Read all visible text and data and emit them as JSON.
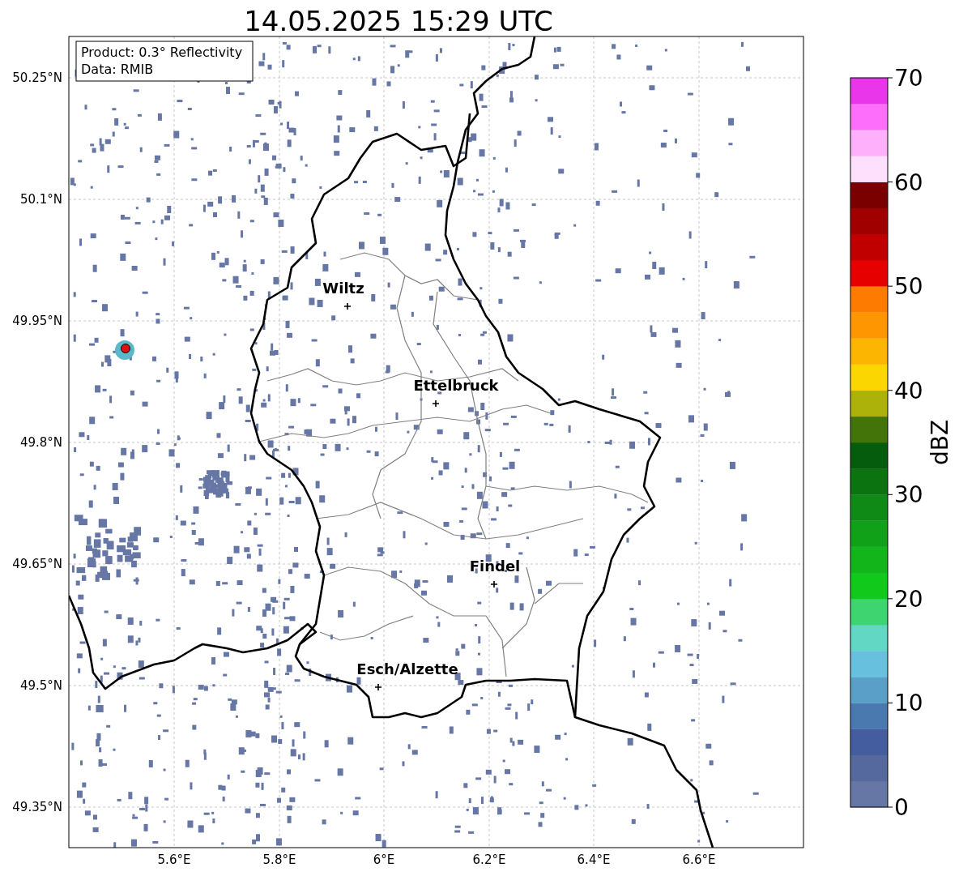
{
  "title": "14.05.2025 15:29 UTC",
  "info_box": [
    "Product: 0.3° Reflectivity",
    "Data: RMIB"
  ],
  "lat_labels": [
    "50.25°N",
    "50.1°N",
    "49.95°N",
    "49.8°N",
    "49.65°N",
    "49.5°N",
    "49.35°N"
  ],
  "lon_labels": [
    "5.6°E",
    "5.8°E",
    "6°E",
    "6.2°E",
    "6.4°E",
    "6.6°E"
  ],
  "places": [
    {
      "name": "Wiltz"
    },
    {
      "name": "Ettelbruck"
    },
    {
      "name": "Findel"
    },
    {
      "name": "Esch/Alzette"
    }
  ],
  "colorbar": {
    "label": "dBZ",
    "ticks": [
      "70",
      "60",
      "50",
      "40",
      "30",
      "20",
      "10",
      "0"
    ],
    "bins": [
      {
        "color": "#6677a5"
      },
      {
        "color": "#55699f"
      },
      {
        "color": "#435d9f"
      },
      {
        "color": "#4a79b0"
      },
      {
        "color": "#5a9fc8"
      },
      {
        "color": "#67c1de"
      },
      {
        "color": "#62d7c4"
      },
      {
        "color": "#3ed571"
      },
      {
        "color": "#11c91b"
      },
      {
        "color": "#12b51a"
      },
      {
        "color": "#10a118"
      },
      {
        "color": "#0f8a17"
      },
      {
        "color": "#0b7411"
      },
      {
        "color": "#065c0d"
      },
      {
        "color": "#427409"
      },
      {
        "color": "#adb20a"
      },
      {
        "color": "#fcd600"
      },
      {
        "color": "#fcb500"
      },
      {
        "color": "#fd9600"
      },
      {
        "color": "#fd7c00"
      },
      {
        "color": "#e60000"
      },
      {
        "color": "#c00000"
      },
      {
        "color": "#a00000"
      },
      {
        "color": "#7a0000"
      },
      {
        "color": "#ffe0fc"
      },
      {
        "color": "#ffb0fb"
      },
      {
        "color": "#fd6ffa"
      },
      {
        "color": "#e936eb"
      }
    ]
  }
}
